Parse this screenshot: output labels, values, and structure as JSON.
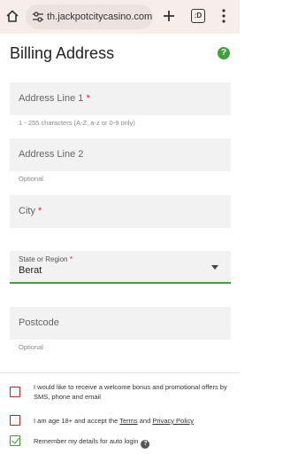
{
  "browser": {
    "url": "th.jackpotcitycasino.com",
    "tab_count": ":D",
    "icons": [
      "home-icon",
      "tune-icon",
      "plus-icon",
      "tabs-icon",
      "kebab-menu-icon"
    ]
  },
  "page": {
    "title": "Billing Address",
    "help_label": "?"
  },
  "form": {
    "address1": {
      "label": "Address Line 1",
      "required_mark": "*",
      "hint": "1 - 255 characters (A-Z, a-z or 0-9 only)"
    },
    "address2": {
      "label": "Address Line 2",
      "hint": "Optional"
    },
    "city": {
      "label": "City",
      "required_mark": "*"
    },
    "state": {
      "label": "State or Region",
      "required_mark": "*",
      "value": "Berat"
    },
    "postcode": {
      "label": "Postcode",
      "hint": "Optional"
    }
  },
  "checkboxes": {
    "promo": {
      "text": "I would like to receive a welcome bonus and promotional offers by SMS, phone and email",
      "checked": false
    },
    "age": {
      "prefix": "I am age 18+ and accept the",
      "terms": "Terms",
      "and": "and",
      "privacy": "Privacy Policy",
      "checked": false
    },
    "remember": {
      "text": "Remember my details for auto login",
      "help": "?",
      "checked": true
    }
  },
  "colors": {
    "accent": "#3fa03b",
    "error": "#e0222f",
    "field_bg": "#f2f2f2",
    "chrome_bg": "#f7eeec"
  }
}
